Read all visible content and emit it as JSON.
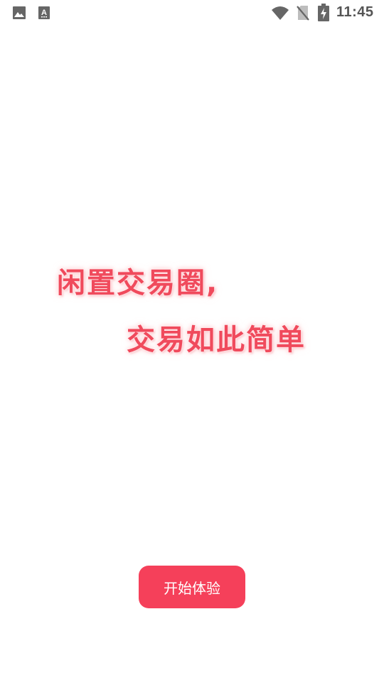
{
  "status_bar": {
    "time": "11:45",
    "icons": [
      "image-icon",
      "font-a-icon",
      "wifi-icon",
      "no-sim-icon",
      "battery-charging-icon"
    ]
  },
  "slogan": {
    "line1": "闲置交易圈,",
    "line2": "交易如此简单"
  },
  "start_button": {
    "label": "开始体验"
  },
  "colors": {
    "accent": "#f5405a",
    "slogan": "#f04a5c",
    "status_icons": "#555555",
    "background": "#ffffff"
  }
}
